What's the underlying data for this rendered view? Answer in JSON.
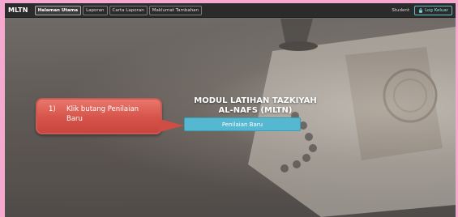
{
  "navbar": {
    "brand": "MLTN",
    "links": [
      "Halaman Utama",
      "Laporan",
      "Carta Laporan",
      "Maklumat Tambahan"
    ],
    "user": "Student",
    "logout": "Log Keluar"
  },
  "hero": {
    "title_line1": "MODUL LATIHAN TAZKIYAH",
    "title_line2": "AL-NAFS (MLTN)",
    "button": "Penilaian Baru"
  },
  "callout": {
    "number": "1)",
    "text": "Klik butang Penilaian Baru"
  },
  "colors": {
    "navbar": "#2b2b2b",
    "button": "#56b8d0",
    "callout": "#d6534a",
    "page_border": "#f6a9cf"
  }
}
